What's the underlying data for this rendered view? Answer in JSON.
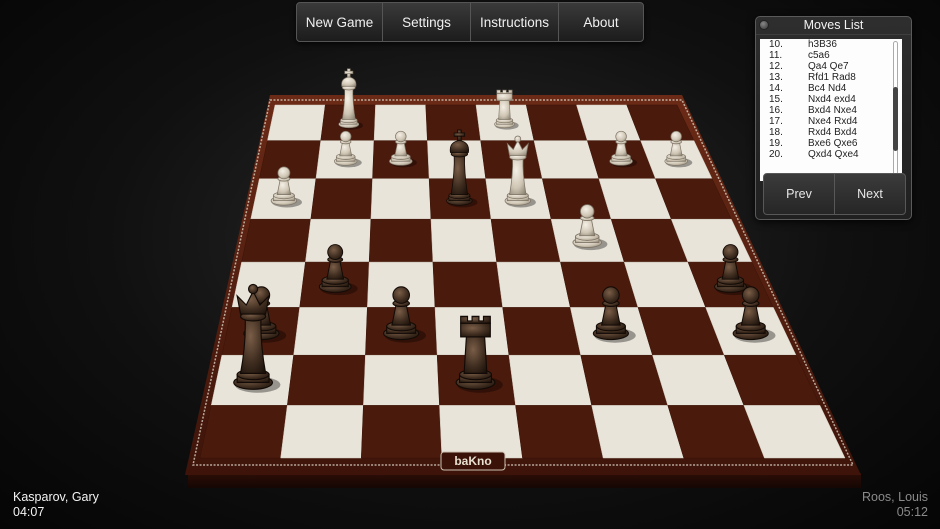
{
  "menu": {
    "new_game": "New Game",
    "settings": "Settings",
    "instructions": "Instructions",
    "about": "About"
  },
  "moves_panel": {
    "title": "Moves List",
    "moves": [
      {
        "num": "10.",
        "text": "h3B36"
      },
      {
        "num": "11.",
        "text": "c5a6"
      },
      {
        "num": "12.",
        "text": "Qa4 Qe7"
      },
      {
        "num": "13.",
        "text": "Rfd1 Rad8"
      },
      {
        "num": "14.",
        "text": "Bc4 Nd4"
      },
      {
        "num": "15.",
        "text": "Nxd4 exd4"
      },
      {
        "num": "16.",
        "text": "Bxd4 Nxe4"
      },
      {
        "num": "17.",
        "text": "Nxe4 Rxd4"
      },
      {
        "num": "18.",
        "text": "Rxd4 Bxd4"
      },
      {
        "num": "19.",
        "text": "Bxe6 Qxe6"
      },
      {
        "num": "20.",
        "text": "Qxd4 Qxe4"
      }
    ],
    "scroll_position": 0.62,
    "prev_label": "Prev",
    "next_label": "Next"
  },
  "board": {
    "logo": "baKno",
    "colors": {
      "frame": "#5a1f10",
      "light_square": "#e9e4da",
      "dark_square": "#4a1a0c",
      "light_piece": "#d8d0c2",
      "dark_piece": "#3a2a1e"
    },
    "pieces": [
      {
        "type": "king",
        "color": "light",
        "file": 1,
        "rank": 7
      },
      {
        "type": "rook",
        "color": "light",
        "file": 4,
        "rank": 7
      },
      {
        "type": "pawn",
        "color": "light",
        "file": 1,
        "rank": 6
      },
      {
        "type": "pawn",
        "color": "light",
        "file": 2,
        "rank": 6
      },
      {
        "type": "pawn",
        "color": "light",
        "file": 6,
        "rank": 6
      },
      {
        "type": "pawn",
        "color": "light",
        "file": 7,
        "rank": 6
      },
      {
        "type": "pawn",
        "color": "light",
        "file": 0,
        "rank": 5
      },
      {
        "type": "king",
        "color": "dark",
        "file": 3,
        "rank": 5
      },
      {
        "type": "queen",
        "color": "light",
        "file": 4,
        "rank": 5
      },
      {
        "type": "pawn",
        "color": "light",
        "file": 5,
        "rank": 4
      },
      {
        "type": "pawn",
        "color": "dark",
        "file": 1,
        "rank": 3
      },
      {
        "type": "pawn",
        "color": "dark",
        "file": 7,
        "rank": 3
      },
      {
        "type": "pawn",
        "color": "dark",
        "file": 0,
        "rank": 2
      },
      {
        "type": "pawn",
        "color": "dark",
        "file": 2,
        "rank": 2
      },
      {
        "type": "pawn",
        "color": "dark",
        "file": 5,
        "rank": 2
      },
      {
        "type": "pawn",
        "color": "dark",
        "file": 7,
        "rank": 2
      },
      {
        "type": "queen",
        "color": "dark",
        "file": 0,
        "rank": 1
      },
      {
        "type": "rook",
        "color": "dark",
        "file": 3,
        "rank": 1
      }
    ]
  },
  "players": {
    "white_name": "Kasparov, Gary",
    "white_time": "04:07",
    "black_name": "Roos, Louis",
    "black_time": "05:12"
  }
}
